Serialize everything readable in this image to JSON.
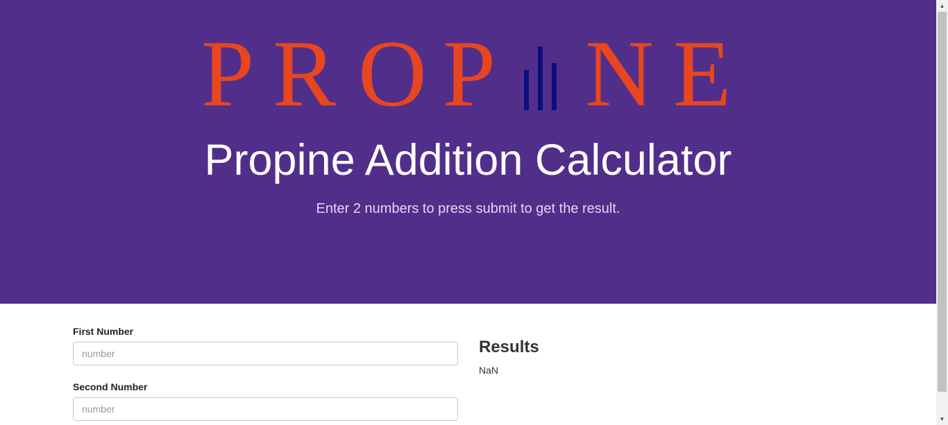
{
  "header": {
    "logo_letters_left": [
      "P",
      "R",
      "O",
      "P"
    ],
    "logo_letters_right": [
      "N",
      "E"
    ],
    "logo_color": "#e8461f",
    "logo_bars_color": "#0b0f7a",
    "title": "Propine Addition Calculator",
    "subtitle": "Enter 2 numbers to press submit to get the result.",
    "background_color": "#522e8b"
  },
  "form": {
    "first": {
      "label": "First Number",
      "placeholder": "number",
      "value": ""
    },
    "second": {
      "label": "Second Number",
      "placeholder": "number",
      "value": ""
    }
  },
  "results": {
    "heading": "Results",
    "value": "NaN"
  },
  "scrollbar": {
    "up_icon": "▲",
    "down_icon": "▼"
  }
}
